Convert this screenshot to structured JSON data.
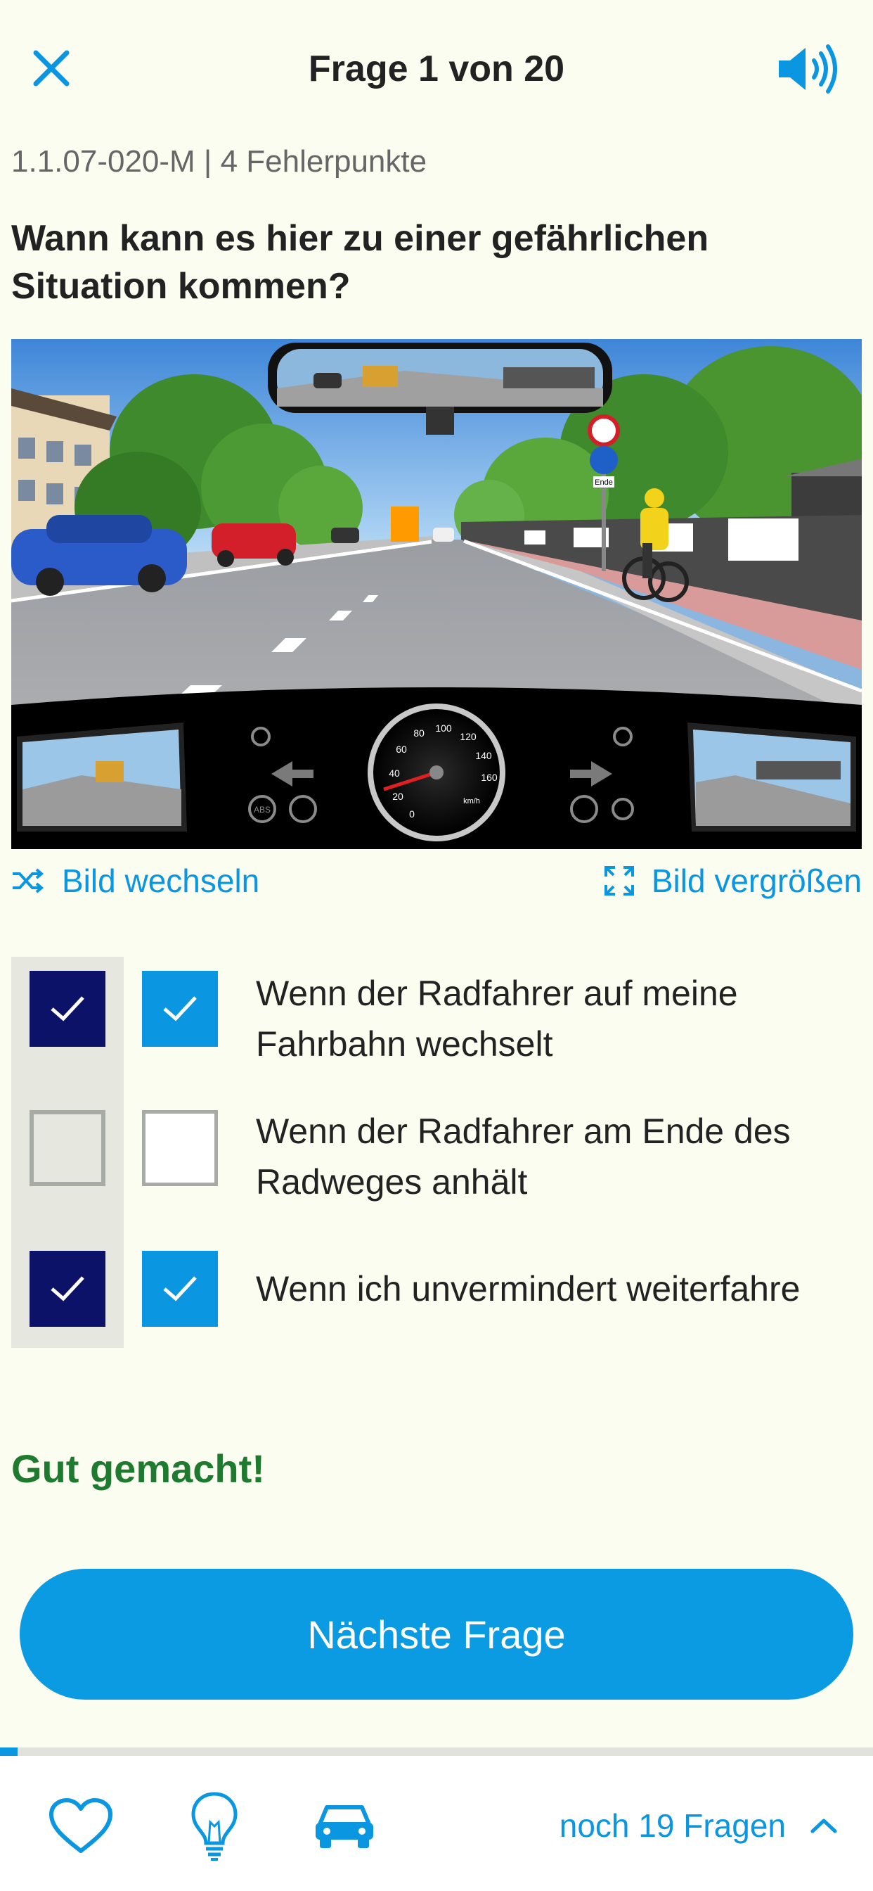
{
  "header": {
    "title": "Frage 1 von 20",
    "close_icon": "close-icon",
    "sound_icon": "speaker-icon"
  },
  "question": {
    "meta": "1.1.07-020-M | 4 Fehlerpunkte",
    "text": "Wann kann es hier zu einer gefährlichen Situation kommen?"
  },
  "scene": {
    "description_icon": "driving-scene-image",
    "sign_label": "Ende",
    "speedo_unit": "km/h",
    "speedo_ticks": [
      "0",
      "20",
      "40",
      "60",
      "80",
      "100",
      "120",
      "140",
      "160"
    ],
    "abs_label": "ABS"
  },
  "image_actions": {
    "change_label": "Bild wechseln",
    "enlarge_label": "Bild vergrößen"
  },
  "answers": [
    {
      "text": "Wenn der Radfahrer auf meine Fahrbahn wechselt",
      "correct": true,
      "selected": true
    },
    {
      "text": "Wenn der Radfahrer am Ende des Radweges anhält",
      "correct": false,
      "selected": false
    },
    {
      "text": "Wenn ich unvermindert weiterfahre",
      "correct": true,
      "selected": true
    }
  ],
  "feedback": "Gut gemacht!",
  "next_button": "Nächste Frage",
  "progress": 0.02,
  "bottom_bar": {
    "remaining": "noch 19 Fragen",
    "icons": [
      "heart-icon",
      "lightbulb-icon",
      "car-icon",
      "chevron-up-icon"
    ]
  },
  "colors": {
    "accent": "#0a96e0",
    "dark_check": "#0c1268",
    "success": "#1e7a2e",
    "background": "#fbfdf0"
  }
}
